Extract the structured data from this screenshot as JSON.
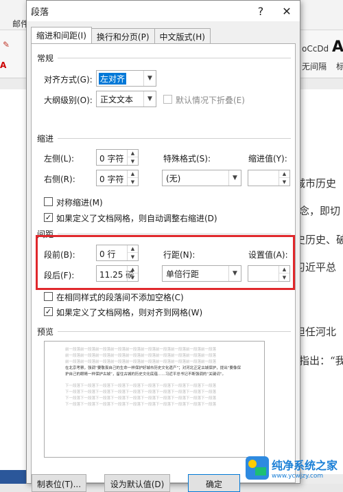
{
  "background": {
    "ribbon_tab": "邮件",
    "style_sample": "oCcDd",
    "style_big": "A",
    "style_label": "无间隔",
    "style_label2": "标",
    "doc_lines": [
      "城市历史",
      "念，即切",
      "史历史、破",
      "习近平总",
      "担任河北",
      "指出：“我"
    ]
  },
  "dialog": {
    "title": "段落",
    "help_label": "?",
    "close_label": "✕",
    "tabs": [
      "缩进和间距(I)",
      "换行和分页(P)",
      "中文版式(H)"
    ],
    "general": {
      "title": "常规",
      "alignment_label": "对齐方式(G):",
      "alignment_value": "左对齐",
      "outline_label": "大纲级别(O):",
      "outline_value": "正文文本",
      "collapse_label": "默认情况下折叠(E)"
    },
    "indent": {
      "title": "缩进",
      "left_label": "左侧(L):",
      "left_value": "0 字符",
      "right_label": "右侧(R):",
      "right_value": "0 字符",
      "special_label": "特殊格式(S):",
      "special_value": "(无)",
      "indent_by_label": "缩进值(Y):",
      "mirror_label": "对称缩进(M)",
      "auto_adjust_label": "如果定义了文档网格，则自动调整右缩进(D)"
    },
    "spacing": {
      "title": "间距",
      "before_label": "段前(B):",
      "before_value": "0 行",
      "after_label": "段后(F):",
      "after_value": "11.25 磅",
      "line_spacing_label": "行距(N):",
      "line_spacing_value": "单倍行距",
      "at_label": "设置值(A):",
      "no_space_label": "在相同样式的段落间不添加空格(C)",
      "snap_grid_label": "如果定义了文档网格，则对齐到网格(W)"
    },
    "preview": {
      "title": "预览",
      "prev_line": "前一段落前一段落前一段落前一段落前一段落前一段落前一段落前一段落前一段落前一段落",
      "body_text": "在北京考察，强调“要敬畏自己的生命一样保护好城市历史文化遗产”；对河北正定古城保护，提出“要像保护自己的眼睛一样保护古城”，留住古城的历史文化底蕴……习近平总书记不断强调的“关键词”。",
      "next_line": "下一段落下一段落下一段落下一段落下一段落下一段落下一段落下一段落下一段落下一段落"
    },
    "buttons": {
      "tabs": "制表位(T)...",
      "default": "设为默认值(D)",
      "ok": "确定"
    }
  },
  "watermark": {
    "title": "纯净系统之家",
    "url": "www.ycwjzy.com"
  },
  "colors": {
    "highlight": "#e0282c",
    "selection": "#0078d7"
  }
}
